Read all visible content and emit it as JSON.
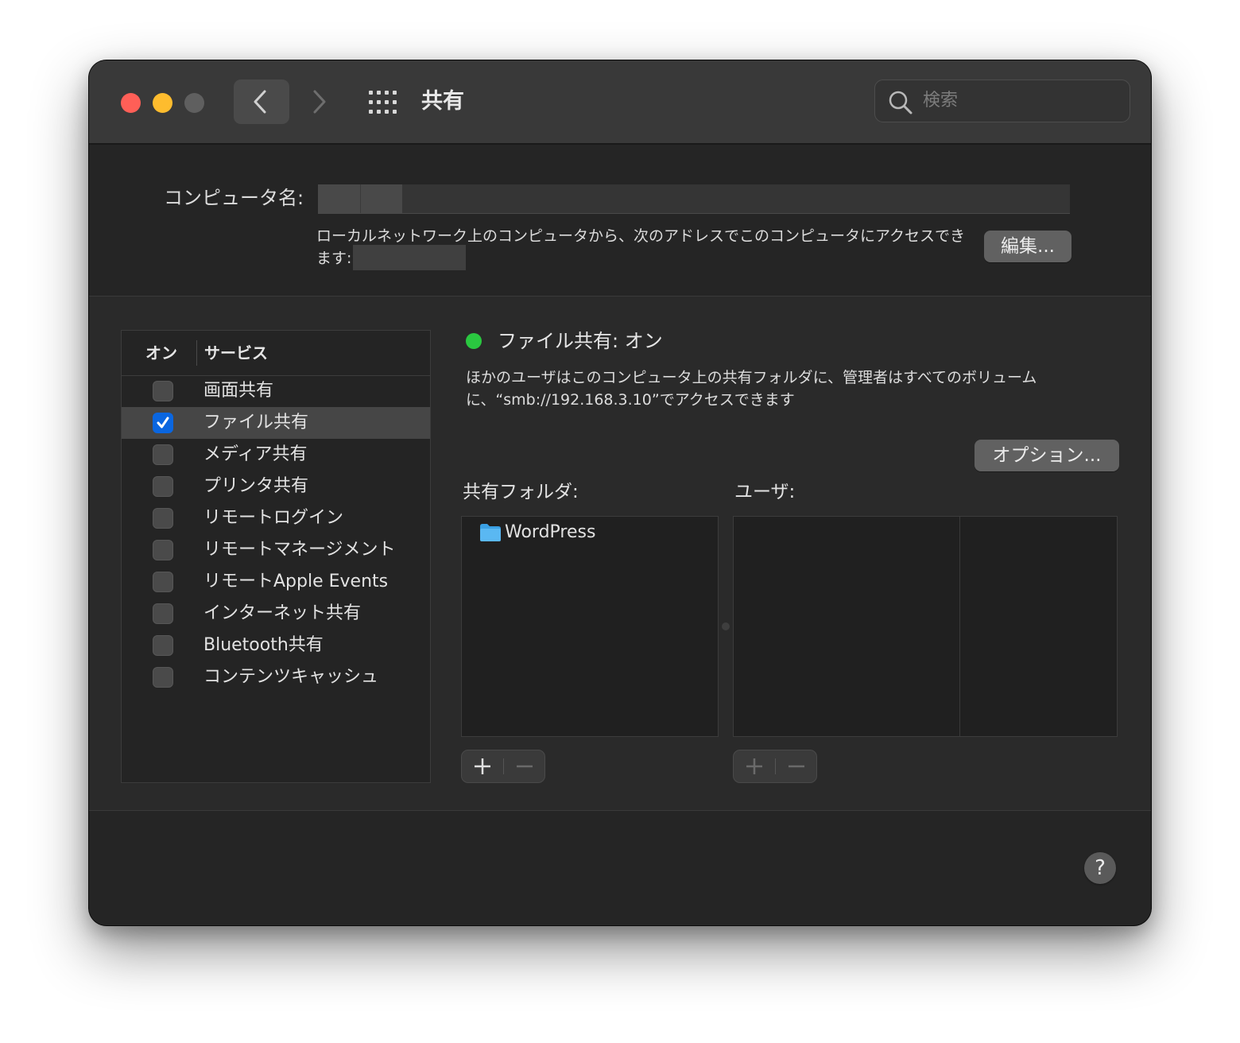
{
  "window": {
    "title": "共有",
    "search": {
      "placeholder": "検索"
    }
  },
  "computer_name": {
    "label": "コンピュータ名:",
    "value": "",
    "address_text": "ローカルネットワーク上のコンピュータから、次のアドレスでこのコンピュータにアクセスできます:",
    "address_value": "",
    "edit_button": "編集..."
  },
  "services": {
    "header_on": "オン",
    "header_service": "サービス",
    "items": [
      {
        "label": "画面共有",
        "checked": false
      },
      {
        "label": "ファイル共有",
        "checked": true,
        "selected": true
      },
      {
        "label": "メディア共有",
        "checked": false
      },
      {
        "label": "プリンタ共有",
        "checked": false
      },
      {
        "label": "リモートログイン",
        "checked": false
      },
      {
        "label": "リモートマネージメント",
        "checked": false
      },
      {
        "label": "リモートApple Events",
        "checked": false
      },
      {
        "label": "インターネット共有",
        "checked": false
      },
      {
        "label": "Bluetooth共有",
        "checked": false
      },
      {
        "label": "コンテンツキャッシュ",
        "checked": false
      }
    ]
  },
  "detail": {
    "status_text": "ファイル共有: オン",
    "status_color": "#2ac840",
    "description": "ほかのユーザはこのコンピュータ上の共有フォルダに、管理者はすべてのボリュームに、“smb://192.168.3.10”でアクセスできます",
    "options_button": "オプション...",
    "shared_folders_label": "共有フォルダ:",
    "users_label": "ユーザ:",
    "shared_folders": [
      {
        "name": "WordPress",
        "icon": "folder-icon"
      }
    ]
  },
  "colors": {
    "accent": "#0a66e0",
    "close": "#ff5f57",
    "minimize": "#febc2e"
  }
}
